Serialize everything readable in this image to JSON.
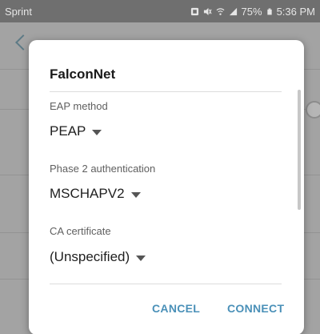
{
  "status_bar": {
    "carrier": "Sprint",
    "battery": "75%",
    "time": "5:36 PM"
  },
  "dialog": {
    "title": "FalconNet",
    "fields": [
      {
        "label": "EAP method",
        "value": "PEAP"
      },
      {
        "label": "Phase 2 authentication",
        "value": "MSCHAPV2"
      },
      {
        "label": "CA certificate",
        "value": "(Unspecified)"
      }
    ],
    "cancel_label": "CANCEL",
    "connect_label": "CONNECT"
  },
  "colors": {
    "accent": "#4a90b8",
    "scrim": "#a3a3a3",
    "dialog_bg": "#ffffff"
  }
}
